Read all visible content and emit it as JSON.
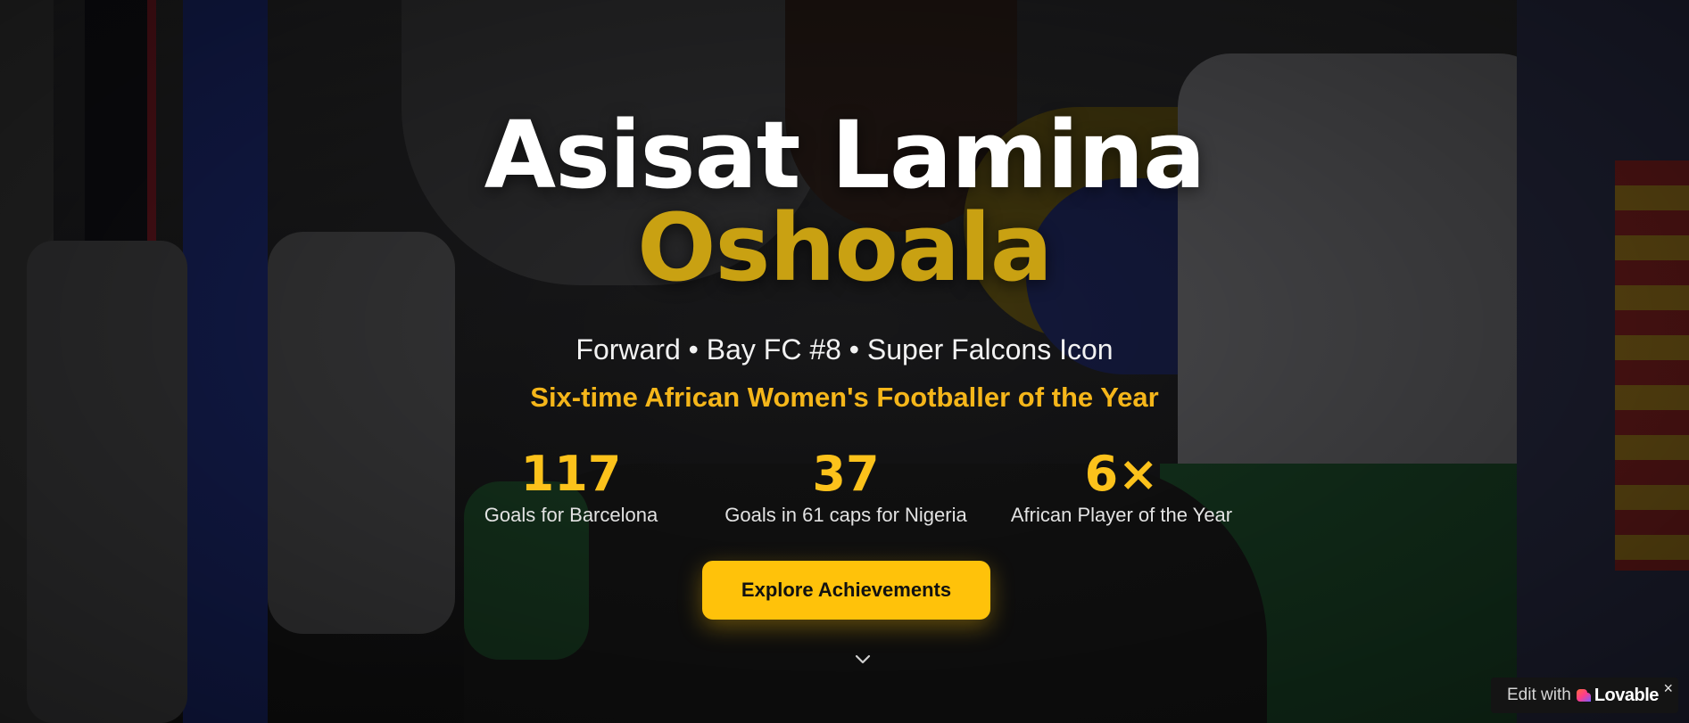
{
  "hero": {
    "first_name": "Asisat Lamina",
    "last_name": "Oshoala",
    "subtitle": "Forward • Bay FC #8 • Super Falcons Icon",
    "tagline": "Six-time African Women's Footballer of the Year",
    "stats": [
      {
        "value": "117",
        "label": "Goals for Barcelona"
      },
      {
        "value": "37",
        "label": "Goals in 61 caps for Nigeria"
      },
      {
        "value": "6×",
        "label": "African Player of the Year"
      }
    ],
    "cta_label": "Explore Achievements",
    "scroll_icon": "chevron-down-icon"
  },
  "badge": {
    "edit_text": "Edit with",
    "brand": "Lovable",
    "close": "×",
    "icon": "lovable-heart-icon"
  },
  "colors": {
    "accent": "#ffc20a",
    "name_gold": "#c9a112",
    "tagline": "#f5b61a"
  }
}
